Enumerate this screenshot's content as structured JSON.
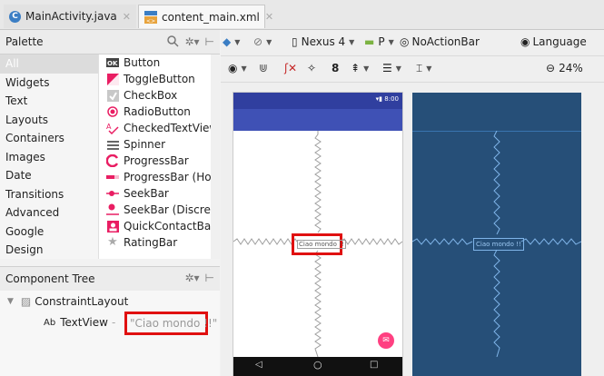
{
  "tabs": [
    {
      "label": "MainActivity.java",
      "icon": "java-class-icon",
      "active": false
    },
    {
      "label": "content_main.xml",
      "icon": "xml-layout-icon",
      "active": true
    }
  ],
  "palette": {
    "title": "Palette",
    "categories": [
      "All",
      "Widgets",
      "Text",
      "Layouts",
      "Containers",
      "Images",
      "Date",
      "Transitions",
      "Advanced",
      "Google",
      "Design"
    ],
    "selected_category": "All",
    "items": [
      {
        "label": "Button",
        "icon": "button-icon"
      },
      {
        "label": "ToggleButton",
        "icon": "toggle-button-icon"
      },
      {
        "label": "CheckBox",
        "icon": "checkbox-icon"
      },
      {
        "label": "RadioButton",
        "icon": "radio-button-icon"
      },
      {
        "label": "CheckedTextView",
        "icon": "checked-text-view-icon"
      },
      {
        "label": "Spinner",
        "icon": "spinner-icon"
      },
      {
        "label": "ProgressBar",
        "icon": "progress-bar-icon"
      },
      {
        "label": "ProgressBar (Ho",
        "icon": "progress-bar-horizontal-icon"
      },
      {
        "label": "SeekBar",
        "icon": "seekbar-icon"
      },
      {
        "label": "SeekBar (Discrete",
        "icon": "seekbar-discrete-icon"
      },
      {
        "label": "QuickContactBa",
        "icon": "quick-contact-badge-icon"
      },
      {
        "label": "RatingBar",
        "icon": "rating-bar-icon"
      }
    ]
  },
  "component_tree": {
    "title": "Component Tree",
    "root": "ConstraintLayout",
    "child_prefix": "Ab",
    "child_type": "TextView",
    "child_text": "\"Ciao mondo !!\""
  },
  "toolbar": {
    "device": "Nexus 4",
    "api": "P",
    "theme": "NoActionBar",
    "language": "Language",
    "margin": "8",
    "zoom": "24%"
  },
  "preview": {
    "status_time": "8:00",
    "text_view": "Ciao mondo !!",
    "blueprint_text": "Ciao mondo !!"
  },
  "colors": {
    "primary": "#3f51b5",
    "primary_dark": "#303f9f",
    "accent": "#ff4081",
    "blueprint": "#264f78",
    "highlight": "#e01010"
  }
}
